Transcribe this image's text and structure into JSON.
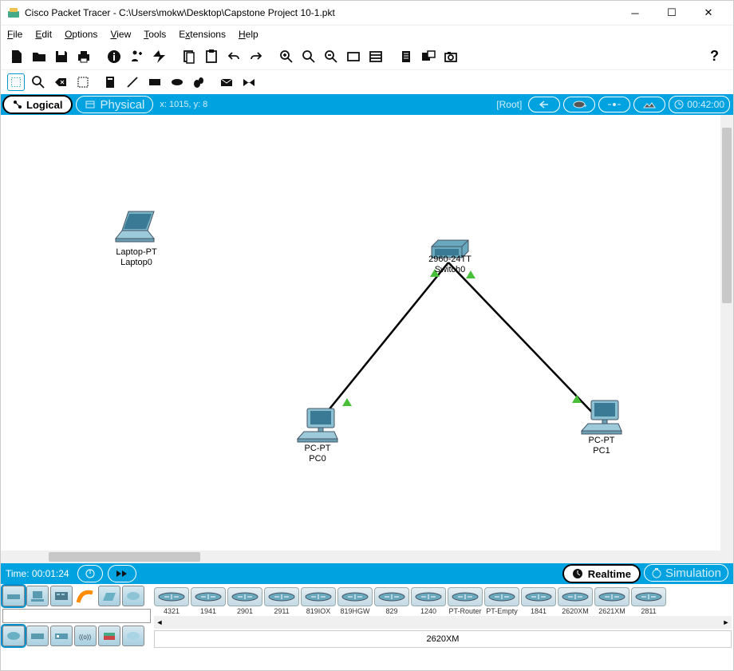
{
  "window": {
    "title": "Cisco Packet Tracer - C:\\Users\\mokw\\Desktop\\Capstone Project 10-1.pkt"
  },
  "menu": {
    "file": "File",
    "edit": "Edit",
    "options": "Options",
    "view": "View",
    "tools": "Tools",
    "extensions": "Extensions",
    "help": "Help"
  },
  "viewbar": {
    "logical": "Logical",
    "physical": "Physical",
    "coords": "x: 1015, y: 8",
    "root": "[Root]",
    "elapsed": "00:42:00"
  },
  "topology": {
    "laptop": {
      "type": "Laptop-PT",
      "name": "Laptop0"
    },
    "switch": {
      "type": "2960-24TT",
      "name": "Switch0"
    },
    "pc0": {
      "type": "PC-PT",
      "name": "PC0"
    },
    "pc1": {
      "type": "PC-PT",
      "name": "PC1"
    }
  },
  "timebar": {
    "time_label": "Time: 00:01:24",
    "realtime": "Realtime",
    "simulation": "Simulation"
  },
  "devices": [
    {
      "label": "4321"
    },
    {
      "label": "1941"
    },
    {
      "label": "2901"
    },
    {
      "label": "2911"
    },
    {
      "label": "819IOX"
    },
    {
      "label": "819HGW"
    },
    {
      "label": "829"
    },
    {
      "label": "1240"
    },
    {
      "label": "PT-Router"
    },
    {
      "label": "PT-Empty"
    },
    {
      "label": "1841"
    },
    {
      "label": "2620XM"
    },
    {
      "label": "2621XM"
    },
    {
      "label": "2811"
    }
  ],
  "selected_device": "2620XM"
}
